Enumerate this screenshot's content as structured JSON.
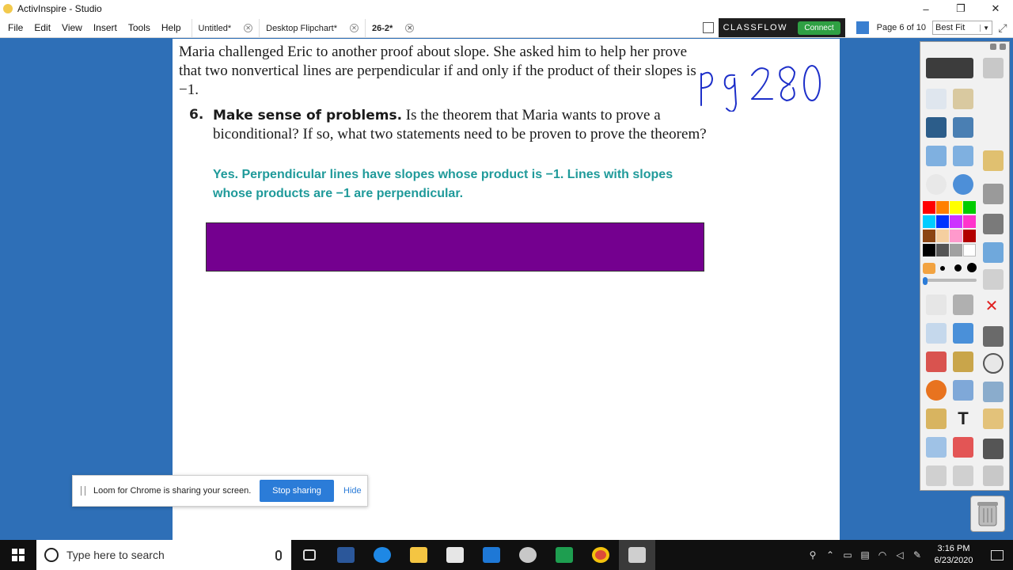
{
  "window": {
    "title": "ActivInspire - Studio",
    "controls": {
      "minimize": "–",
      "maximize": "❐",
      "close": "✕"
    }
  },
  "menu": {
    "items": [
      "File",
      "Edit",
      "View",
      "Insert",
      "Tools",
      "Help"
    ],
    "tabs": [
      {
        "label": "Untitled*",
        "active": false
      },
      {
        "label": "Desktop Flipchart*",
        "active": false
      },
      {
        "label": "26-2*",
        "active": true
      }
    ],
    "classflow_logo": "CLASSFLOW",
    "connect_label": "Connect",
    "page_indicator": "Page 6 of 10",
    "zoom_value": "Best Fit"
  },
  "page": {
    "intro": "Maria challenged Eric to another proof about slope. She asked him to help her prove that two nonvertical lines are perpendicular if and only if the product of their slopes is −1.",
    "question_number": "6.",
    "question_heading": "Make sense of problems.",
    "question_text": "Is the theorem that Maria wants to prove a biconditional? If so, what two statements need to be proven to prove the theorem?",
    "answer": "Yes. Perpendicular lines have slopes whose product is −1. Lines with slopes whose products are −1 are perpendicular.",
    "handwritten_note": "pg 280",
    "cover_box_color": "#74008f"
  },
  "toolbox": {
    "palette": [
      "#ff0000",
      "#ff8000",
      "#ffff00",
      "#00cc00",
      "#00ccff",
      "#0033ff",
      "#cc33ff",
      "#ff33cc",
      "#8b4513",
      "#f5cfa0",
      "#ff99cc",
      "#b30000",
      "#000000",
      "#555555",
      "#a0a0a0",
      "#ffffff"
    ]
  },
  "loom": {
    "message": "Loom for Chrome is sharing your screen.",
    "stop_label": "Stop sharing",
    "hide_label": "Hide"
  },
  "taskbar": {
    "search_placeholder": "Type here to search",
    "time": "3:16 PM",
    "date": "6/23/2020"
  }
}
